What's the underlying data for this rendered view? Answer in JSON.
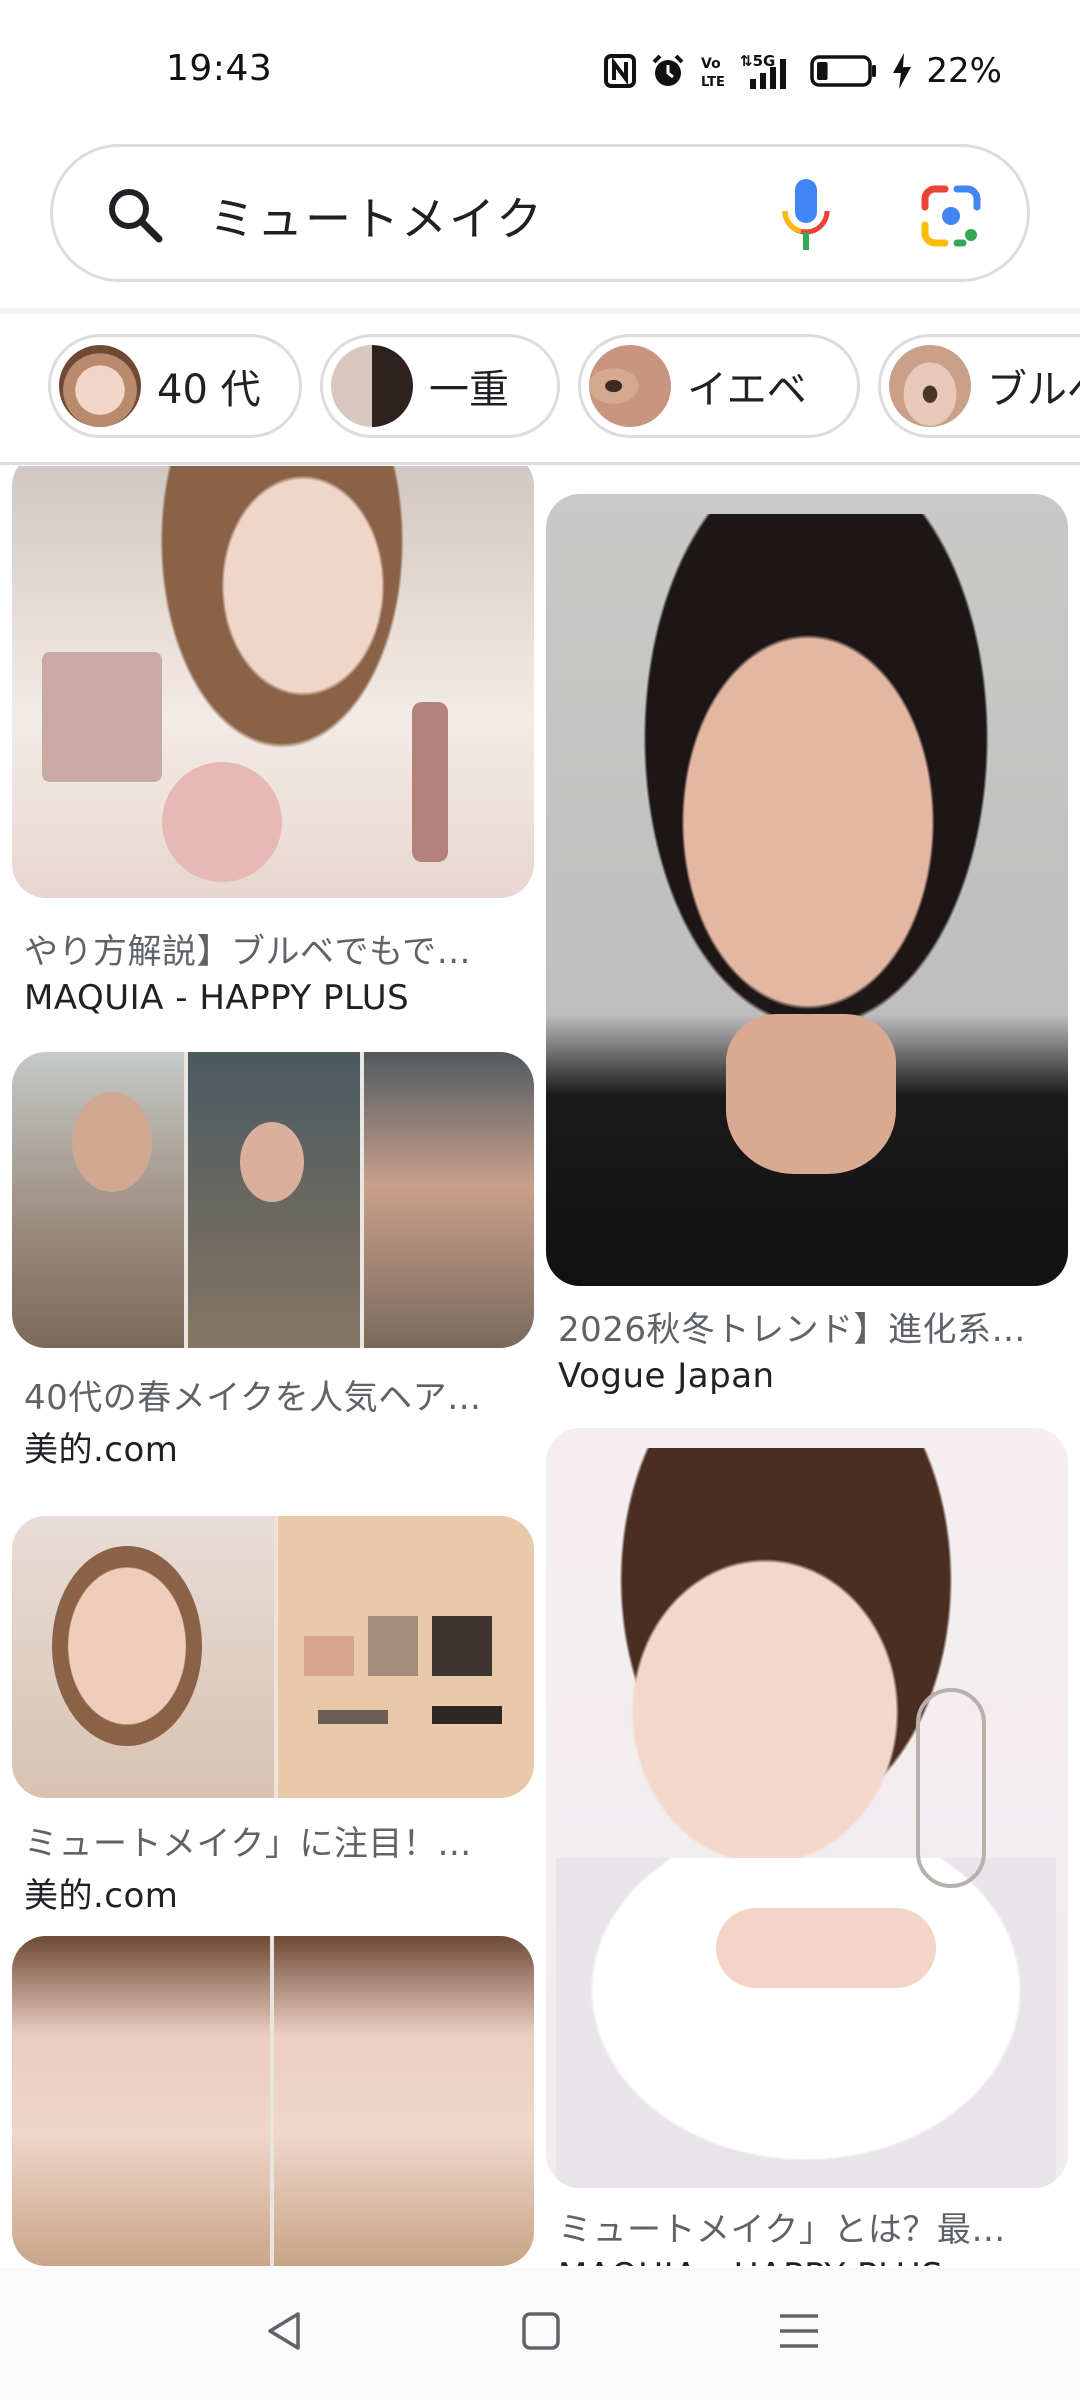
{
  "status_bar": {
    "time": "19:43",
    "icons": [
      "nfc-icon",
      "alarm-icon",
      "volte-icon",
      "signal-5g-icon",
      "battery-icon",
      "charging-icon"
    ],
    "battery_percent": "22%",
    "battery_level": 0.22
  },
  "search": {
    "query": "ミュートメイク"
  },
  "chips": [
    {
      "label": "40 代"
    },
    {
      "label": "一重"
    },
    {
      "label": "イエベ"
    },
    {
      "label": "ブルベ"
    }
  ],
  "results": {
    "left": [
      {
        "title": "やり方解説】ブルベでもで…",
        "source": "MAQUIA - HAPPY PLUS"
      },
      {
        "title": "40代の春メイクを人気ヘア…",
        "source": "美的.com"
      },
      {
        "title": "ミュートメイク」に注目！…",
        "source": "美的.com"
      },
      {
        "title": "",
        "source": ""
      }
    ],
    "right": [
      {
        "title": "2026秋冬トレンド】進化系…",
        "source": "Vogue Japan"
      },
      {
        "title": "ミュートメイク」とは？最…",
        "source": "MAQUIA - HAPPY PLUS"
      }
    ]
  },
  "nav": {
    "icons": [
      "back-icon",
      "home-icon",
      "recents-icon"
    ]
  },
  "colors": {
    "google_blue": "#4285F4",
    "google_red": "#EA4335",
    "google_yellow": "#FBBC05",
    "google_green": "#34A853"
  }
}
